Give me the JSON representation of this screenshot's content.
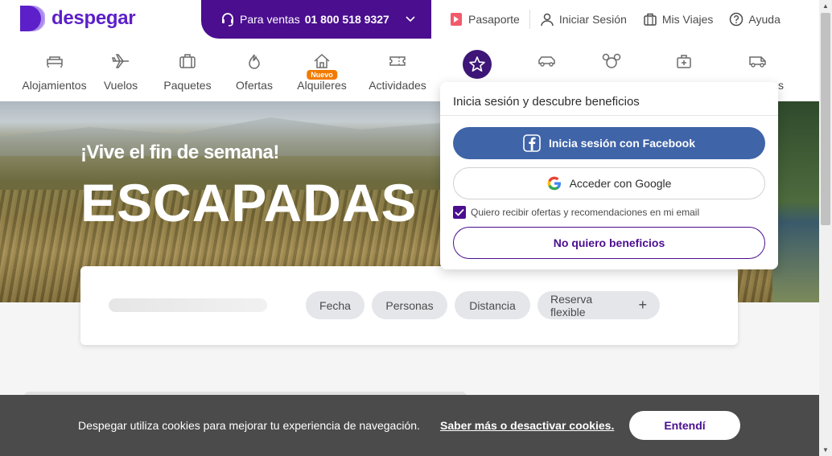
{
  "brand": {
    "name": "despegar",
    "color": "#5c1fc9"
  },
  "sales": {
    "label": "Para ventas",
    "phone": "01 800 518 9327"
  },
  "toplinks": [
    {
      "label": "Pasaporte",
      "icon": "passport-icon"
    },
    {
      "label": "Iniciar Sesión",
      "icon": "user-icon"
    },
    {
      "label": "Mis Viajes",
      "icon": "suitcase-icon"
    },
    {
      "label": "Ayuda",
      "icon": "help-icon"
    }
  ],
  "nav": {
    "items": [
      {
        "label": "Alojamientos",
        "icon": "bed-icon"
      },
      {
        "label": "Vuelos",
        "icon": "plane-icon"
      },
      {
        "label": "Paquetes",
        "icon": "package-icon"
      },
      {
        "label": "Ofertas",
        "icon": "offers-icon"
      },
      {
        "label": "Alquileres",
        "icon": "house-icon",
        "badge": "Nuevo"
      },
      {
        "label": "Actividades",
        "icon": "ticket-icon"
      }
    ],
    "hidden_label_tail": "s"
  },
  "hero": {
    "subtitle": "¡Vive el fin de semana!",
    "title": "ESCAPADAS"
  },
  "search": {
    "chips": [
      "Fecha",
      "Personas",
      "Distancia"
    ],
    "flexible": "Reserva flexible"
  },
  "login_dropdown": {
    "title": "Inicia sesión y descubre beneficios",
    "facebook": "Inicia sesión con Facebook",
    "google": "Acceder con Google",
    "checkbox_label": "Quiero recibir ofertas y recomendaciones en mi email",
    "checkbox_checked": true,
    "decline": "No quiero beneficios"
  },
  "cookies": {
    "text": "Despegar utiliza cookies para mejorar tu experiencia de navegación.",
    "link": "Saber más o desactivar cookies.",
    "accept": "Entendí"
  },
  "colors": {
    "accent": "#4a0e8f",
    "facebook": "#3f64a8",
    "badge": "#f27a00",
    "cookie_bg": "#4b4b4b"
  }
}
